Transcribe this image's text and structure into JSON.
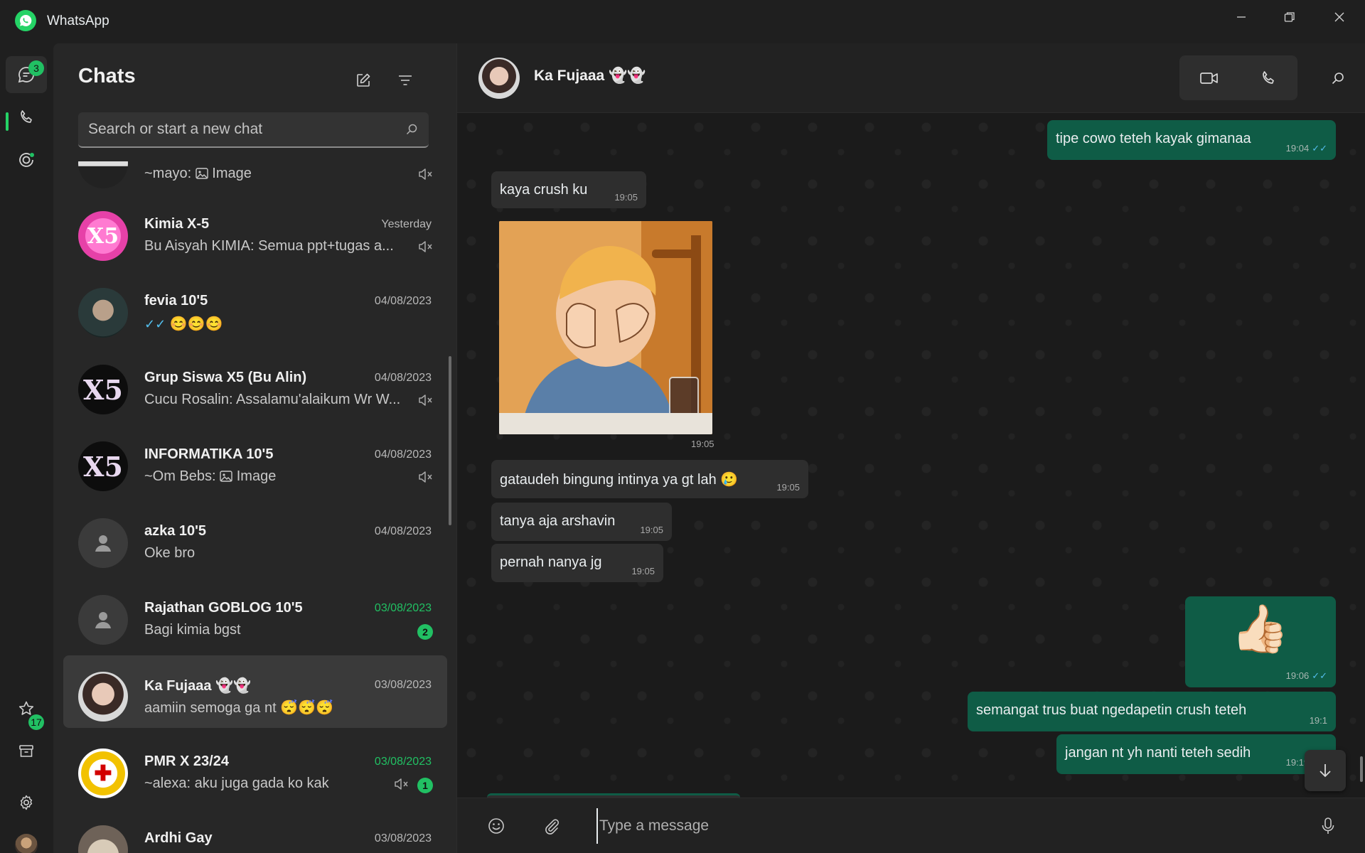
{
  "app": {
    "title": "WhatsApp"
  },
  "window": {
    "minimize_icon": "minimize-icon",
    "maximize_icon": "restore-icon",
    "close_icon": "close-icon"
  },
  "rail": {
    "chats_badge": "3",
    "archive_badge": "17",
    "icons": [
      "chats-icon",
      "calls-icon",
      "status-icon",
      "starred-icon",
      "archive-icon",
      "settings-icon",
      "profile-avatar"
    ]
  },
  "chatlist": {
    "title": "Chats",
    "search_placeholder": "Search or start a new chat",
    "chats": [
      {
        "name": "",
        "date": "",
        "preview_sender": "~mayo:",
        "preview": "Image",
        "muted": true
      },
      {
        "name": "Kimia X-5",
        "date": "Yesterday",
        "preview": "Bu Aisyah KIMIA: Semua ppt+tugas a...",
        "muted": true
      },
      {
        "name": "fevia 10'5",
        "date": "04/08/2023",
        "preview": "😊😊😊",
        "read_ticks": true
      },
      {
        "name": "Grup Siswa X5 (Bu Alin)",
        "date": "04/08/2023",
        "preview": "Cucu Rosalin: Assalamu'alaikum Wr W...",
        "muted": true
      },
      {
        "name": "INFORMATIKA 10'5",
        "date": "04/08/2023",
        "preview_sender": "~Om Bebs:",
        "preview": "Image",
        "muted": true
      },
      {
        "name": "azka 10'5",
        "date": "04/08/2023",
        "preview": "Oke bro"
      },
      {
        "name": "Rajathan GOBLOG 10'5",
        "date": "03/08/2023",
        "preview": "Bagi kimia bgst",
        "unread": "2"
      },
      {
        "name": "Ka Fujaaa 👻👻",
        "date": "03/08/2023",
        "preview": "aamiin semoga ga nt 😴😴😴",
        "selected": true
      },
      {
        "name": "PMR X 23/24",
        "date": "03/08/2023",
        "preview": "~alexa: aku juga gada ko kak",
        "muted": true,
        "unread": "1"
      },
      {
        "name": "Ardhi Gay",
        "date": "03/08/2023",
        "preview": ""
      }
    ]
  },
  "conversation": {
    "contact_name": "Ka Fujaaa 👻👻",
    "messages": [
      {
        "dir": "out",
        "text": "tipe cowo teteh kayak gimanaa",
        "time": "19:04"
      },
      {
        "dir": "in",
        "text": "kaya crush ku",
        "time": "19:05"
      },
      {
        "dir": "in",
        "type": "sticker",
        "time": "19:05"
      },
      {
        "dir": "in",
        "text": "gataudeh bingung intinya ya gt lah 🥲",
        "time": "19:05"
      },
      {
        "dir": "in",
        "text": "tanya aja arshavin",
        "time": "19:05"
      },
      {
        "dir": "in",
        "text": "pernah nanya jg",
        "time": "19:05"
      },
      {
        "dir": "out",
        "text": "👍🏻",
        "time": "19:06"
      },
      {
        "dir": "out",
        "text": "semangat trus buat ngedapetin crush teteh",
        "time": "19:1"
      },
      {
        "dir": "out",
        "text": "jangan nt yh nanti teteh sedih",
        "time": "19:19"
      }
    ],
    "composer_placeholder": "Type a message"
  }
}
